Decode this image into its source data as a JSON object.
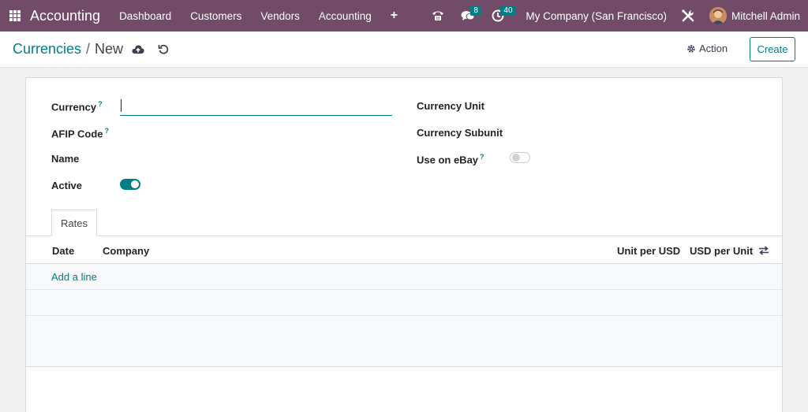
{
  "navbar": {
    "brand": "Accounting",
    "menu": [
      "Dashboard",
      "Customers",
      "Vendors",
      "Accounting"
    ],
    "plus": "+",
    "messages_count": "8",
    "activities_count": "40",
    "company": "My Company (San Francisco)",
    "user": "Mitchell Admin"
  },
  "control_panel": {
    "breadcrumb_parent": "Currencies",
    "breadcrumb_sep": "/",
    "breadcrumb_current": "New",
    "action_label": "Action",
    "create_label": "Create"
  },
  "form": {
    "currency_label": "Currency",
    "currency_value": "",
    "afip_label": "AFIP Code",
    "name_label": "Name",
    "active_label": "Active",
    "active_value": true,
    "currency_unit_label": "Currency Unit",
    "currency_subunit_label": "Currency Subunit",
    "ebay_label": "Use on eBay",
    "ebay_value": false,
    "help_mark": "?"
  },
  "notebook": {
    "tab_label": "Rates",
    "columns": {
      "date": "Date",
      "company": "Company",
      "unit_per_usd": "Unit per USD",
      "usd_per_unit": "USD per Unit"
    },
    "add_line": "Add a line"
  },
  "colors": {
    "navbar": "#714b67",
    "accent": "#017e84"
  }
}
